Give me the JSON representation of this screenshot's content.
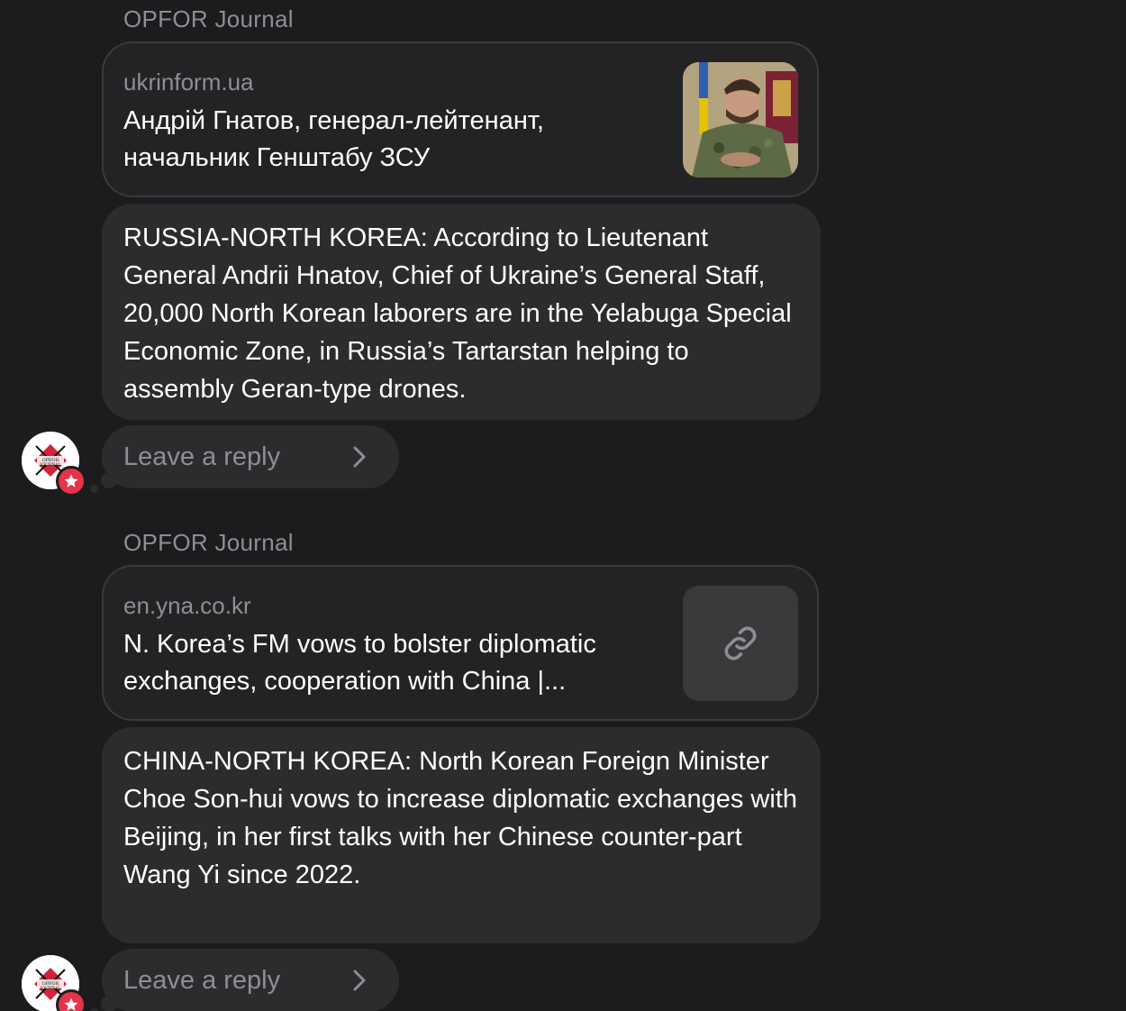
{
  "posts": [
    {
      "sender": "OPFOR Journal",
      "link": {
        "domain": "ukrinform.ua",
        "title": "Андрій Гнатов, генерал-лейтенант, начальник Генштабу ЗСУ",
        "thumbnail": "photo-of-general"
      },
      "message": "RUSSIA-NORTH KOREA: According to Lieutenant General Andrii Hnatov, Chief of Ukraine’s General Staff, 20,000 North Korean laborers are in the Yelabuga Special Economic Zone, in Russia’s Tartarstan helping to assembly Geran-type drones.",
      "reply_placeholder": "Leave a reply",
      "avatar": {
        "logo_text": "OPFOR JOURNAL",
        "badge": "star-icon"
      }
    },
    {
      "sender": "OPFOR Journal",
      "link": {
        "domain": "en.yna.co.kr",
        "title": "N. Korea’s FM vows to bolster diplomatic exchanges, cooperation with China |...",
        "thumbnail": "link-icon"
      },
      "message": "CHINA-NORTH KOREA: North Korean Foreign Minister Choe Son-hui vows to increase diplomatic exchanges with Beijing, in her first talks with her Chinese counter-part Wang Yi since 2022.",
      "reply_placeholder": "Leave a reply",
      "avatar": {
        "logo_text": "OPFOR JOURNAL",
        "badge": "star-icon"
      }
    }
  ],
  "colors": {
    "background": "#1c1c1e",
    "bubble": "#2c2c2e",
    "link_card": "#232325",
    "muted_text": "#8e8e93",
    "badge": "#e5334b"
  }
}
